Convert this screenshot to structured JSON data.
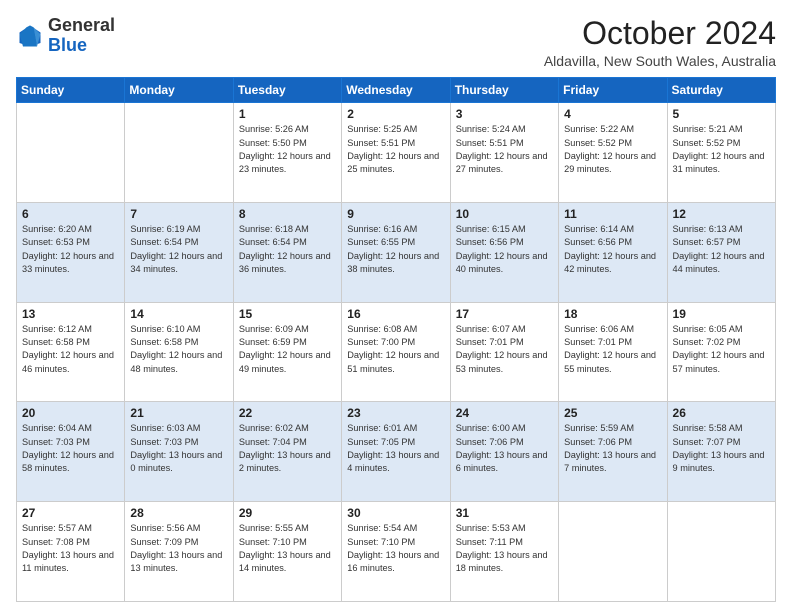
{
  "header": {
    "logo": {
      "general": "General",
      "blue": "Blue"
    },
    "title": "October 2024",
    "location": "Aldavilla, New South Wales, Australia"
  },
  "days_of_week": [
    "Sunday",
    "Monday",
    "Tuesday",
    "Wednesday",
    "Thursday",
    "Friday",
    "Saturday"
  ],
  "weeks": [
    [
      {
        "day": "",
        "sunrise": "",
        "sunset": "",
        "daylight": ""
      },
      {
        "day": "",
        "sunrise": "",
        "sunset": "",
        "daylight": ""
      },
      {
        "day": "1",
        "sunrise": "Sunrise: 5:26 AM",
        "sunset": "Sunset: 5:50 PM",
        "daylight": "Daylight: 12 hours and 23 minutes."
      },
      {
        "day": "2",
        "sunrise": "Sunrise: 5:25 AM",
        "sunset": "Sunset: 5:51 PM",
        "daylight": "Daylight: 12 hours and 25 minutes."
      },
      {
        "day": "3",
        "sunrise": "Sunrise: 5:24 AM",
        "sunset": "Sunset: 5:51 PM",
        "daylight": "Daylight: 12 hours and 27 minutes."
      },
      {
        "day": "4",
        "sunrise": "Sunrise: 5:22 AM",
        "sunset": "Sunset: 5:52 PM",
        "daylight": "Daylight: 12 hours and 29 minutes."
      },
      {
        "day": "5",
        "sunrise": "Sunrise: 5:21 AM",
        "sunset": "Sunset: 5:52 PM",
        "daylight": "Daylight: 12 hours and 31 minutes."
      }
    ],
    [
      {
        "day": "6",
        "sunrise": "Sunrise: 6:20 AM",
        "sunset": "Sunset: 6:53 PM",
        "daylight": "Daylight: 12 hours and 33 minutes."
      },
      {
        "day": "7",
        "sunrise": "Sunrise: 6:19 AM",
        "sunset": "Sunset: 6:54 PM",
        "daylight": "Daylight: 12 hours and 34 minutes."
      },
      {
        "day": "8",
        "sunrise": "Sunrise: 6:18 AM",
        "sunset": "Sunset: 6:54 PM",
        "daylight": "Daylight: 12 hours and 36 minutes."
      },
      {
        "day": "9",
        "sunrise": "Sunrise: 6:16 AM",
        "sunset": "Sunset: 6:55 PM",
        "daylight": "Daylight: 12 hours and 38 minutes."
      },
      {
        "day": "10",
        "sunrise": "Sunrise: 6:15 AM",
        "sunset": "Sunset: 6:56 PM",
        "daylight": "Daylight: 12 hours and 40 minutes."
      },
      {
        "day": "11",
        "sunrise": "Sunrise: 6:14 AM",
        "sunset": "Sunset: 6:56 PM",
        "daylight": "Daylight: 12 hours and 42 minutes."
      },
      {
        "day": "12",
        "sunrise": "Sunrise: 6:13 AM",
        "sunset": "Sunset: 6:57 PM",
        "daylight": "Daylight: 12 hours and 44 minutes."
      }
    ],
    [
      {
        "day": "13",
        "sunrise": "Sunrise: 6:12 AM",
        "sunset": "Sunset: 6:58 PM",
        "daylight": "Daylight: 12 hours and 46 minutes."
      },
      {
        "day": "14",
        "sunrise": "Sunrise: 6:10 AM",
        "sunset": "Sunset: 6:58 PM",
        "daylight": "Daylight: 12 hours and 48 minutes."
      },
      {
        "day": "15",
        "sunrise": "Sunrise: 6:09 AM",
        "sunset": "Sunset: 6:59 PM",
        "daylight": "Daylight: 12 hours and 49 minutes."
      },
      {
        "day": "16",
        "sunrise": "Sunrise: 6:08 AM",
        "sunset": "Sunset: 7:00 PM",
        "daylight": "Daylight: 12 hours and 51 minutes."
      },
      {
        "day": "17",
        "sunrise": "Sunrise: 6:07 AM",
        "sunset": "Sunset: 7:01 PM",
        "daylight": "Daylight: 12 hours and 53 minutes."
      },
      {
        "day": "18",
        "sunrise": "Sunrise: 6:06 AM",
        "sunset": "Sunset: 7:01 PM",
        "daylight": "Daylight: 12 hours and 55 minutes."
      },
      {
        "day": "19",
        "sunrise": "Sunrise: 6:05 AM",
        "sunset": "Sunset: 7:02 PM",
        "daylight": "Daylight: 12 hours and 57 minutes."
      }
    ],
    [
      {
        "day": "20",
        "sunrise": "Sunrise: 6:04 AM",
        "sunset": "Sunset: 7:03 PM",
        "daylight": "Daylight: 12 hours and 58 minutes."
      },
      {
        "day": "21",
        "sunrise": "Sunrise: 6:03 AM",
        "sunset": "Sunset: 7:03 PM",
        "daylight": "Daylight: 13 hours and 0 minutes."
      },
      {
        "day": "22",
        "sunrise": "Sunrise: 6:02 AM",
        "sunset": "Sunset: 7:04 PM",
        "daylight": "Daylight: 13 hours and 2 minutes."
      },
      {
        "day": "23",
        "sunrise": "Sunrise: 6:01 AM",
        "sunset": "Sunset: 7:05 PM",
        "daylight": "Daylight: 13 hours and 4 minutes."
      },
      {
        "day": "24",
        "sunrise": "Sunrise: 6:00 AM",
        "sunset": "Sunset: 7:06 PM",
        "daylight": "Daylight: 13 hours and 6 minutes."
      },
      {
        "day": "25",
        "sunrise": "Sunrise: 5:59 AM",
        "sunset": "Sunset: 7:06 PM",
        "daylight": "Daylight: 13 hours and 7 minutes."
      },
      {
        "day": "26",
        "sunrise": "Sunrise: 5:58 AM",
        "sunset": "Sunset: 7:07 PM",
        "daylight": "Daylight: 13 hours and 9 minutes."
      }
    ],
    [
      {
        "day": "27",
        "sunrise": "Sunrise: 5:57 AM",
        "sunset": "Sunset: 7:08 PM",
        "daylight": "Daylight: 13 hours and 11 minutes."
      },
      {
        "day": "28",
        "sunrise": "Sunrise: 5:56 AM",
        "sunset": "Sunset: 7:09 PM",
        "daylight": "Daylight: 13 hours and 13 minutes."
      },
      {
        "day": "29",
        "sunrise": "Sunrise: 5:55 AM",
        "sunset": "Sunset: 7:10 PM",
        "daylight": "Daylight: 13 hours and 14 minutes."
      },
      {
        "day": "30",
        "sunrise": "Sunrise: 5:54 AM",
        "sunset": "Sunset: 7:10 PM",
        "daylight": "Daylight: 13 hours and 16 minutes."
      },
      {
        "day": "31",
        "sunrise": "Sunrise: 5:53 AM",
        "sunset": "Sunset: 7:11 PM",
        "daylight": "Daylight: 13 hours and 18 minutes."
      },
      {
        "day": "",
        "sunrise": "",
        "sunset": "",
        "daylight": ""
      },
      {
        "day": "",
        "sunrise": "",
        "sunset": "",
        "daylight": ""
      }
    ]
  ]
}
